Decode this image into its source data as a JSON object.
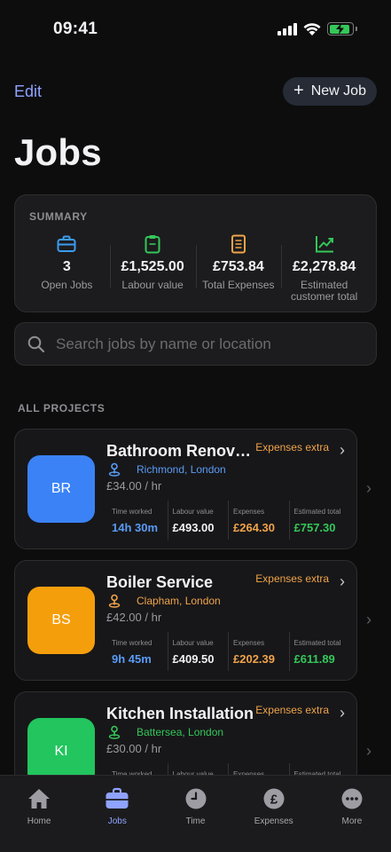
{
  "status_bar": {
    "time": "09:41"
  },
  "header": {
    "edit_label": "Edit",
    "new_job_label": "New Job",
    "title": "Jobs"
  },
  "summary": {
    "label": "SUMMARY",
    "items": [
      {
        "icon": "briefcase-icon",
        "value": "3",
        "caption": "Open Jobs",
        "color": "#3b9cf2"
      },
      {
        "icon": "clipboard-icon",
        "value": "£1,525.00",
        "caption": "Labour value",
        "color": "#34c759"
      },
      {
        "icon": "receipt-icon",
        "value": "£753.84",
        "caption": "Total Expenses",
        "color": "#f0a34a"
      },
      {
        "icon": "trend-up-icon",
        "value": "£2,278.84",
        "caption": "Estimated customer total",
        "color": "#34c759"
      }
    ]
  },
  "search": {
    "placeholder": "Search jobs by name or location"
  },
  "section_header": "ALL PROJECTS",
  "jobs": [
    {
      "initials": "BR",
      "avatar_color": "#3b82f6",
      "name": "Bathroom Renovation",
      "badge": "Expenses extra",
      "location": "Richmond, London",
      "location_color": "#5a9bf5",
      "rate": "£34.00 / hr",
      "metrics": [
        {
          "label": "Time worked",
          "value": "14h 30m",
          "color": "#5a9bf5"
        },
        {
          "label": "Labour value",
          "value": "£493.00",
          "color": "#f2f2f4"
        },
        {
          "label": "Expenses",
          "value": "£264.30",
          "color": "#f0a34a"
        },
        {
          "label": "Estimated total",
          "value": "£757.30",
          "color": "#34c759"
        }
      ]
    },
    {
      "initials": "BS",
      "avatar_color": "#f59e0b",
      "name": "Boiler Service",
      "badge": "Expenses extra",
      "location": "Clapham, London",
      "location_color": "#f0a34a",
      "rate": "£42.00 / hr",
      "metrics": [
        {
          "label": "Time worked",
          "value": "9h 45m",
          "color": "#5a9bf5"
        },
        {
          "label": "Labour value",
          "value": "£409.50",
          "color": "#f2f2f4"
        },
        {
          "label": "Expenses",
          "value": "£202.39",
          "color": "#f0a34a"
        },
        {
          "label": "Estimated total",
          "value": "£611.89",
          "color": "#34c759"
        }
      ]
    },
    {
      "initials": "KI",
      "avatar_color": "#22c55e",
      "name": "Kitchen Installation",
      "badge": "Expenses extra",
      "location": "Battersea, London",
      "location_color": "#34c759",
      "rate": "£30.00 / hr",
      "metrics": [
        {
          "label": "Time worked",
          "value": "",
          "color": "#5a9bf5"
        },
        {
          "label": "Labour value",
          "value": "",
          "color": "#f2f2f4"
        },
        {
          "label": "Expenses",
          "value": "",
          "color": "#f0a34a"
        },
        {
          "label": "Estimated total",
          "value": "",
          "color": "#34c759"
        }
      ]
    }
  ],
  "tab_bar": {
    "tabs": [
      {
        "label": "Home",
        "icon": "house-icon",
        "active": false
      },
      {
        "label": "Jobs",
        "icon": "briefcase-icon",
        "active": true
      },
      {
        "label": "Time",
        "icon": "clock-icon",
        "active": false
      },
      {
        "label": "Expenses",
        "icon": "pound-icon",
        "active": false
      },
      {
        "label": "More",
        "icon": "ellipsis-icon",
        "active": false
      }
    ]
  }
}
